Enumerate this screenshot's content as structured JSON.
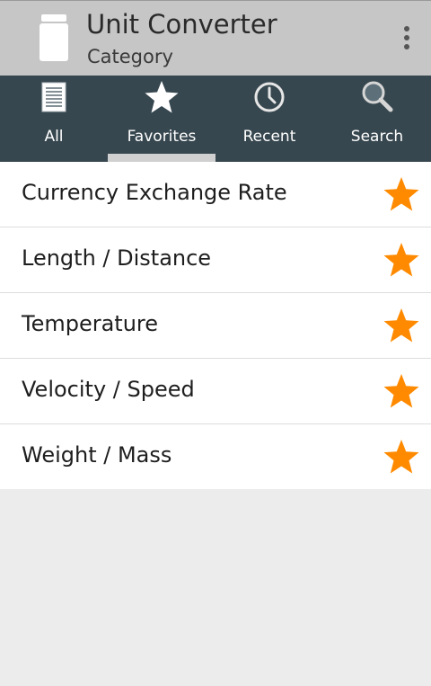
{
  "header": {
    "title": "Unit Converter",
    "subtitle": "Category",
    "app_icon": "jar-icon",
    "overflow_icon": "overflow-menu-icon"
  },
  "tabs": [
    {
      "label": "All",
      "icon": "list-icon",
      "selected": false
    },
    {
      "label": "Favorites",
      "icon": "star-icon",
      "selected": true
    },
    {
      "label": "Recent",
      "icon": "clock-icon",
      "selected": false
    },
    {
      "label": "Search",
      "icon": "search-icon",
      "selected": false
    }
  ],
  "favorites": [
    {
      "label": "Currency Exchange Rate",
      "starred": true
    },
    {
      "label": "Length / Distance",
      "starred": true
    },
    {
      "label": "Temperature",
      "starred": true
    },
    {
      "label": "Velocity / Speed",
      "starred": true
    },
    {
      "label": "Weight / Mass",
      "starred": true
    }
  ],
  "colors": {
    "action_bar": "#c6c6c6",
    "tab_bar": "#37474f",
    "star": "#ff8a00",
    "background": "#ececec"
  }
}
